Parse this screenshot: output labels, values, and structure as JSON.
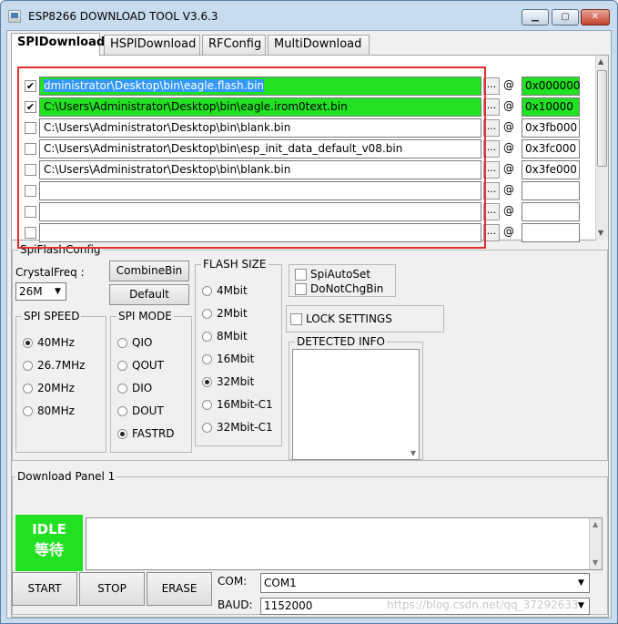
{
  "window": {
    "title": "ESP8266 DOWNLOAD TOOL V3.6.3"
  },
  "tabs": [
    {
      "label": "SPIDownload"
    },
    {
      "label": "HSPIDownload"
    },
    {
      "label": "RFConfig"
    },
    {
      "label": "MultiDownload"
    }
  ],
  "files": [
    {
      "checked": true,
      "path": "dministrator\\Desktop\\bin\\eagle.flash.bin",
      "address": "0x000000"
    },
    {
      "checked": true,
      "path": "C:\\Users\\Administrator\\Desktop\\bin\\eagle.irom0text.bin",
      "address": "0x10000"
    },
    {
      "checked": false,
      "path": "C:\\Users\\Administrator\\Desktop\\bin\\blank.bin",
      "address": "0x3fb000"
    },
    {
      "checked": false,
      "path": "C:\\Users\\Administrator\\Desktop\\bin\\esp_init_data_default_v08.bin",
      "address": "0x3fc000"
    },
    {
      "checked": false,
      "path": "C:\\Users\\Administrator\\Desktop\\bin\\blank.bin",
      "address": "0x3fe000"
    },
    {
      "checked": false,
      "path": "",
      "address": ""
    },
    {
      "checked": false,
      "path": "",
      "address": ""
    },
    {
      "checked": false,
      "path": "",
      "address": ""
    }
  ],
  "file_row": {
    "browse_label": "...",
    "at_label": "@",
    "check_mark": "✔"
  },
  "spi_flash_config": {
    "title": "SpiFlashConfig",
    "crystal_label": "CrystalFreq :",
    "crystal_value": "26M",
    "combine_bin_label": "CombineBin",
    "default_label": "Default",
    "spi_speed": {
      "title": "SPI SPEED",
      "options": [
        "40MHz",
        "26.7MHz",
        "20MHz",
        "80MHz"
      ],
      "selected": "40MHz"
    },
    "spi_mode": {
      "title": "SPI MODE",
      "options": [
        "QIO",
        "QOUT",
        "DIO",
        "DOUT",
        "FASTRD"
      ],
      "selected": "FASTRD"
    },
    "flash_size": {
      "title": "FLASH SIZE",
      "options": [
        "4Mbit",
        "2Mbit",
        "8Mbit",
        "16Mbit",
        "32Mbit",
        "16Mbit-C1",
        "32Mbit-C1"
      ],
      "selected": "32Mbit"
    },
    "spi_auto_set": "SpiAutoSet",
    "do_not_chg_bin": "DoNotChgBin",
    "lock_settings": "LOCK SETTINGS",
    "detected_info": "DETECTED INFO"
  },
  "download_panel": {
    "title": "Download Panel 1",
    "status_en": "IDLE",
    "status_cn": "等待",
    "start_label": "START",
    "stop_label": "STOP",
    "erase_label": "ERASE",
    "com_label": "COM:",
    "com_value": "COM1",
    "baud_label": "BAUD:",
    "baud_value": "1152000"
  },
  "watermark": "https://blog.csdn.net/qq_37292633",
  "colors": {
    "selected_row": "#22e022",
    "idle_status": "#22e022",
    "annotation_box": "#e03030",
    "text_highlight": "#3399ff"
  }
}
